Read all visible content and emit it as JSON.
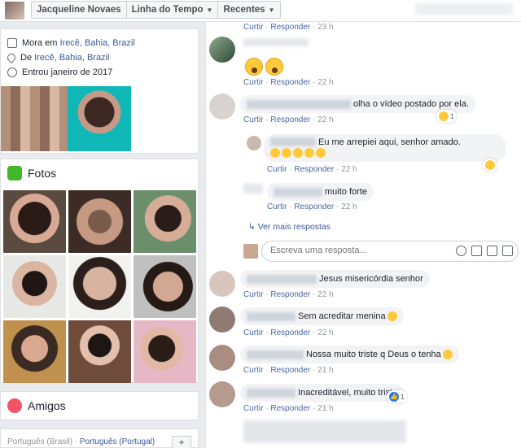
{
  "topbar": {
    "tabs": [
      {
        "label": "Jacqueline Novaes"
      },
      {
        "label": "Linha do Tempo"
      },
      {
        "label": "Recentes"
      }
    ]
  },
  "intro": {
    "lives_prefix": "Mora em ",
    "lives_link": "Irecê, Bahia, Brazil",
    "from_prefix": "De ",
    "from_link": "Irecê, Bahia, Brazil",
    "joined": "Entrou janeiro de 2017"
  },
  "photos": {
    "title": "Fotos"
  },
  "friends": {
    "title": "Amigos"
  },
  "footer": {
    "lang1": "Português (Brasil)",
    "sep": " · ",
    "lang2": "Português (Portugal)",
    "add": "+"
  },
  "actions": {
    "like": "Curtir",
    "reply": "Responder",
    "dot": " · "
  },
  "comments": [
    {
      "text": "",
      "time": "23 h"
    },
    {
      "text": "",
      "time": "22 h"
    },
    {
      "text": "olha o vídeo postado por ela.",
      "time": "22 h",
      "react_count": "1"
    },
    {
      "text": "Eu me arrepiei aqui, senhor amado.",
      "time": "22 h"
    },
    {
      "text": "muito forte",
      "time": "22 h"
    },
    {
      "text": "Jesus misericórdia senhor",
      "time": "22 h"
    },
    {
      "text": "Sem acreditar menina",
      "time": "22 h"
    },
    {
      "text": "Nossa muito triste q Deus o tenha",
      "time": "21 h"
    },
    {
      "text": "Inacreditável, muito triste",
      "time": "21 h",
      "react_count": "1"
    }
  ],
  "more_replies": "Ver mais respostas",
  "reply_input": {
    "placeholder": "Escreva uma resposta..."
  },
  "colors": {
    "link": "#385898",
    "meta": "#90949c",
    "bubble": "#f2f3f5"
  }
}
